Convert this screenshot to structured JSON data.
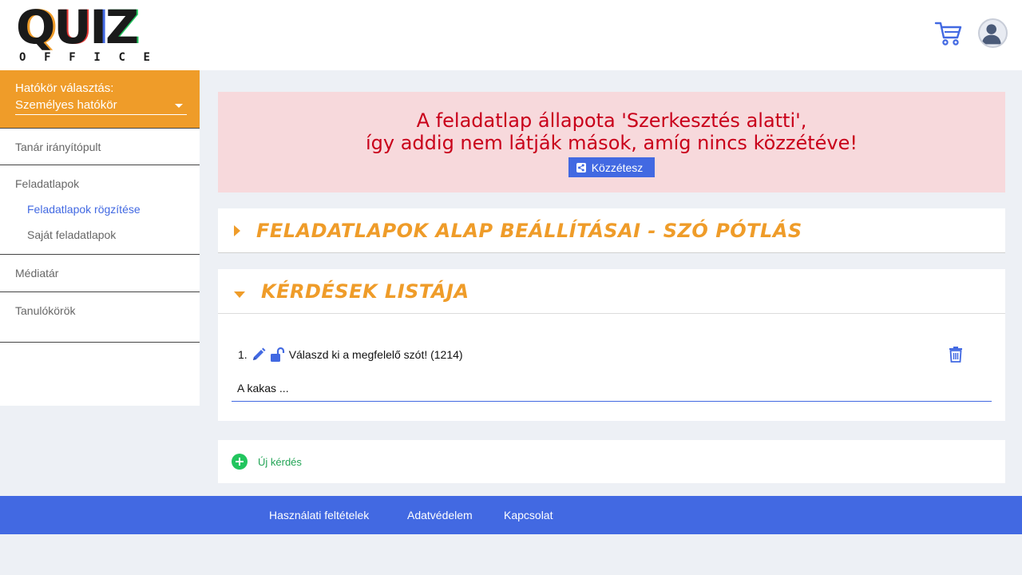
{
  "brand": {
    "letters": [
      "Q",
      "U",
      "I",
      "Z"
    ],
    "letter_colors": [
      "#1a1a1a",
      "#1a1a1a",
      "#1a1a1a",
      "#1a1a1a"
    ],
    "accent_colors": [
      "#ef9c29",
      "#e53935",
      "#4269e2",
      "#22c55e"
    ],
    "sub_letters": [
      "O",
      "F",
      "F",
      "I",
      "C",
      "E"
    ]
  },
  "header": {
    "cart_icon": "shopping-cart-icon",
    "avatar_icon": "user-avatar-icon"
  },
  "sidebar": {
    "scope_label": "Hatókör választás:",
    "scope_value": "Személyes hatókör",
    "items": [
      {
        "label": "Tanár irányítópult"
      },
      {
        "label": "Feladatlapok"
      },
      {
        "label": "Feladatlapok rögzítése"
      },
      {
        "label": "Saját feladatlapok"
      },
      {
        "label": "Médiatár"
      },
      {
        "label": "Tanulókörök"
      }
    ]
  },
  "alert": {
    "line1": "A feladatlap állapota 'Szerkesztés alatti',",
    "line2": "így addig nem látják mások, amíg nincs közzétéve!",
    "publish_label": "Közzétesz"
  },
  "panels": {
    "settings_title": "FELADATLAPOK ALAP BEÁLLÍTÁSAI - SZÓ PÓTLÁS",
    "questions_title": "KÉRDÉSEK LISTÁJA"
  },
  "question": {
    "number": "1.",
    "text": "Válaszd ki a megfelelő szót! (1214)",
    "answer": "A kakas ..."
  },
  "new_question": {
    "label": "Új kérdés"
  },
  "footer": {
    "terms": "Használati feltételek",
    "privacy": "Adatvédelem",
    "contact": "Kapcsolat"
  },
  "colors": {
    "accent_orange": "#ef9c29",
    "primary_blue": "#4269e2",
    "alert_bg": "#f7d9dc",
    "alert_text": "#c9001a",
    "success_green": "#22c55e"
  }
}
